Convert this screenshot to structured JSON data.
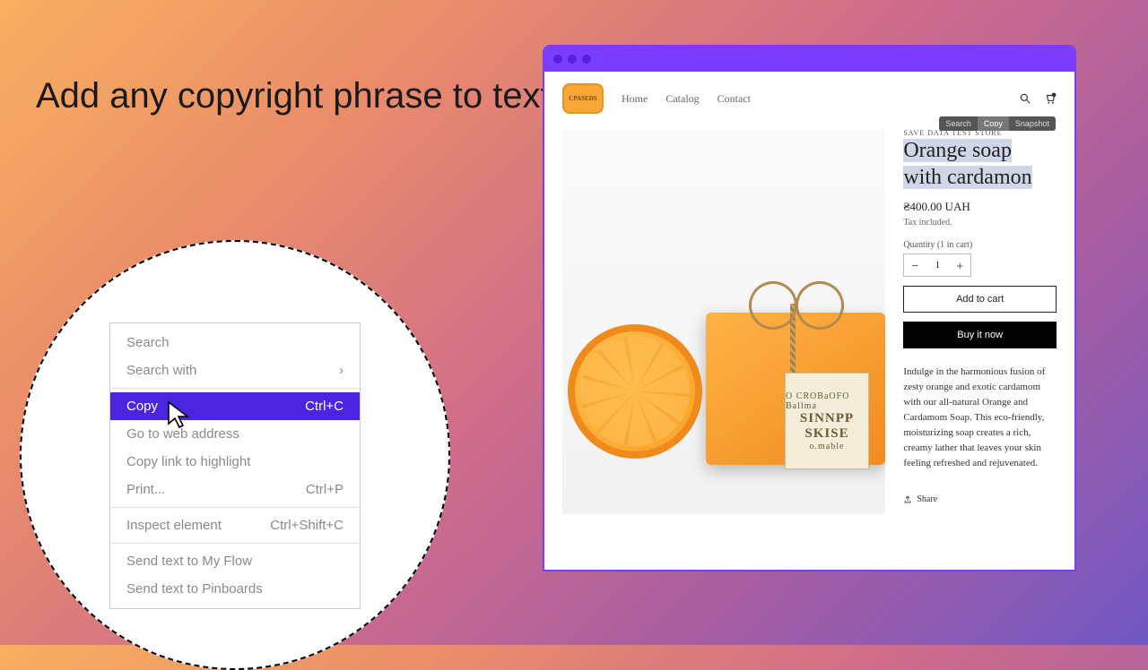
{
  "headline": "Add any copyright phrase to text copied from your shop",
  "context_menu": {
    "search": "Search",
    "search_with": "Search with",
    "copy": "Copy",
    "copy_shortcut": "Ctrl+C",
    "go_to": "Go to web address",
    "copy_link": "Copy link to highlight",
    "print": "Print...",
    "print_shortcut": "Ctrl+P",
    "inspect": "Inspect element",
    "inspect_shortcut": "Ctrl+Shift+C",
    "send_flow": "Send text to My Flow",
    "send_pinboards": "Send text to Pinboards"
  },
  "nav": {
    "brand": "CPASEDS",
    "home": "Home",
    "catalog": "Catalog",
    "contact": "Contact"
  },
  "tooltip": {
    "search": "Search",
    "copy": "Copy",
    "snapshot": "Snapshot"
  },
  "product": {
    "store_badge": "SAVE DATA TEST STORE",
    "title_l1": "Orange soap",
    "title_l2": "with cardamon",
    "price": "₴400.00 UAH",
    "tax": "Tax included.",
    "qty_label": "Quantity (1 in cart)",
    "qty_value": "1",
    "add_to_cart": "Add to cart",
    "buy_now": "Buy it now",
    "description": "Indulge in the harmonious fusion of zesty orange and exotic cardamom with our all-natural Orange and Cardamom Soap. This eco-friendly, moisturizing soap creates a rich, creamy lather that leaves your skin feeling refreshed and rejuvenated.",
    "share": "Share",
    "label_tag_top": "O CROBaOFO Ballma",
    "label_tag_b1": "SINNPP",
    "label_tag_b2": "SKISE",
    "label_tag_bot": "o.mable"
  }
}
